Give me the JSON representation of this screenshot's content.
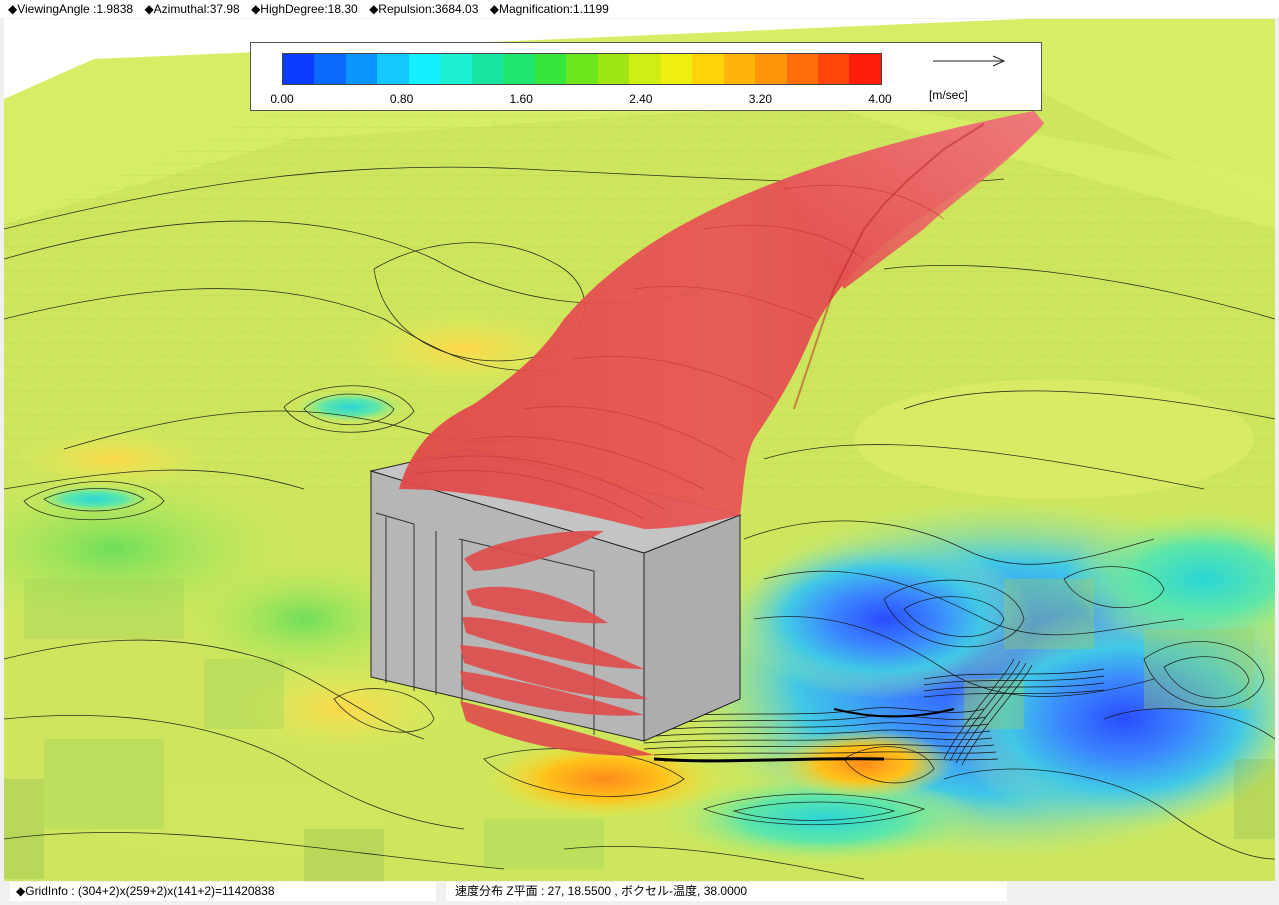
{
  "header": {
    "params": [
      "◆ViewingAngle :1.9838",
      "◆Azimuthal:37.98",
      "◆HighDegree:18.30",
      "◆Repulsion:3684.03",
      "◆Magnification:1.1199"
    ]
  },
  "legend": {
    "colors": [
      "#0a3cff",
      "#0a6aff",
      "#0a96ff",
      "#12c8ff",
      "#14f0ff",
      "#1cf0d2",
      "#18e6a0",
      "#1ee66e",
      "#36e63c",
      "#6ee61e",
      "#a0e614",
      "#cfee12",
      "#f0ee10",
      "#ffd20a",
      "#ffb40a",
      "#ff960a",
      "#ff6e0a",
      "#ff460a",
      "#ff1e0a"
    ],
    "ticks": [
      "0.00",
      "0.80",
      "1.60",
      "2.40",
      "3.20",
      "4.00"
    ],
    "unit": "[m/sec]"
  },
  "footer": {
    "grid_info": "◆GridInfo : (304+2)x(259+2)x(141+2)=11420838",
    "plane_info": "速度分布 Z平面 : 27,  18.5500  ,  ボクセル-温度,  38.0000"
  }
}
